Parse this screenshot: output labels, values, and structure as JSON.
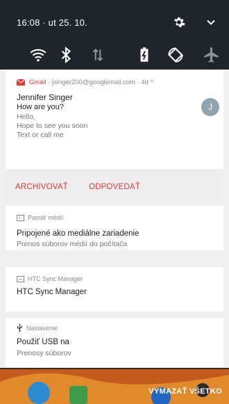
{
  "status": {
    "datetime": "16:08 · ut 25. 10.",
    "icons": [
      "gear-icon",
      "chevron-down-icon"
    ]
  },
  "quick_settings": [
    "wifi-icon",
    "bluetooth-icon",
    "mobile-data-icon",
    "battery-saver-icon",
    "auto-rotate-icon",
    "airplane-mode-icon"
  ],
  "gmail": {
    "app": "Gmail",
    "account": " · jsinger200@googlemail.com · 4d ^",
    "sender": "Jennifer Singer",
    "subject": "How are you?",
    "lines": [
      "Hello,",
      "Hope to see you soon",
      "Text or call me"
    ],
    "avatar_letter": "J",
    "accent": "#e53935"
  },
  "actions": {
    "archive": "ARCHIVOVAŤ",
    "reply": "ODPOVEDAŤ"
  },
  "media": {
    "meta": "Pamäť médií",
    "title": "Pripojené ako mediálne zariadenie",
    "subtitle": "Prenos súborov médií do počítača"
  },
  "sync": {
    "meta": "HTC Sync Manager",
    "title": "HTC Sync Manager"
  },
  "usb": {
    "meta": "Nastavenie",
    "title": "Použiť USB na",
    "subtitle": "Prenosy súborov"
  },
  "footer": {
    "clear_all": "VYMAZAŤ VŠETKO"
  }
}
